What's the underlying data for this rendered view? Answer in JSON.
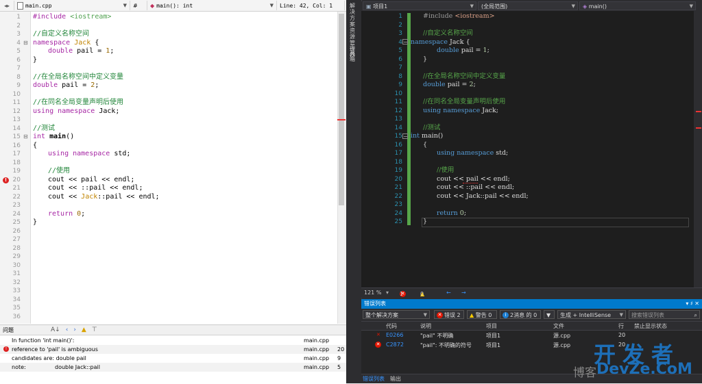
{
  "left_editor": {
    "file_tab": "main.cpp",
    "symbol_hash": "#",
    "function_sig": "main(): int",
    "position": "Line: 42, Col: 1",
    "line_numbers": [
      "1",
      "2",
      "3",
      "4",
      "5",
      "6",
      "7",
      "8",
      "9",
      "10",
      "11",
      "12",
      "13",
      "14",
      "15",
      "16",
      "17",
      "18",
      "19",
      "20",
      "21",
      "22",
      "23",
      "24",
      "25",
      "26",
      "27",
      "28",
      "29",
      "30",
      "31",
      "32",
      "33",
      "34",
      "35",
      "36"
    ],
    "code": {
      "l1_kw": "#include",
      "l1_inc": " <iostream>",
      "l3": "//自定义名称空间",
      "l4_kw": "namespace",
      "l4_name": " Jack",
      "l4_rest": " {",
      "l5_ty": "double",
      "l5_rest": " pail = ",
      "l5_num": "1",
      "l5_end": ";",
      "l6": "}",
      "l8": "//在全局名称空间中定义变量",
      "l9_ty": "double",
      "l9_rest": " pail = ",
      "l9_num": "2",
      "l9_end": ";",
      "l11": "//在同名全局变量声明后使用",
      "l12_kw": "using namespace",
      "l12_rest": " Jack;",
      "l14": "//测试",
      "l15_ty": "int",
      "l15_fn": " main",
      "l15_rest": "()",
      "l16": "{",
      "l17_kw": "using namespace",
      "l17_rest": " std;",
      "l19": "//使用",
      "l20": "cout << pail << endl;",
      "l21": "cout << ::pail << endl;",
      "l22_a": "cout << ",
      "l22_ns": "Jack",
      "l22_b": "::pail << endl;",
      "l24_kw": "return",
      "l24_num": " 0",
      "l24_end": ";",
      "l25": "}"
    }
  },
  "problems": {
    "title": "问题",
    "rows": [
      {
        "msg": "In function 'int main()':",
        "file": "main.cpp",
        "line": ""
      },
      {
        "msg": "reference to 'pail' is ambiguous",
        "file": "main.cpp",
        "line": "20"
      },
      {
        "msg": "candidates are: double pail",
        "file": "main.cpp",
        "line": "9"
      },
      {
        "msg": "note:",
        "msg2": "double Jack::pail",
        "file": "main.cpp",
        "line": "5"
      }
    ]
  },
  "vs": {
    "side_tabs": [
      "解决方案资源管理器",
      "工具箱"
    ],
    "nav_project": "项目1",
    "nav_scope": "(全局范围)",
    "nav_func": "main()",
    "line_numbers": [
      "1",
      "2",
      "3",
      "4",
      "5",
      "6",
      "7",
      "8",
      "9",
      "10",
      "11",
      "12",
      "13",
      "14",
      "15",
      "16",
      "17",
      "18",
      "19",
      "20",
      "21",
      "22",
      "23",
      "24",
      "25"
    ],
    "code": {
      "l1_pre": "#include",
      "l1_inc": " <iostream>",
      "l3": "//自定义名称空间",
      "l4_kw": "namespace",
      "l4_rest": " Jack {",
      "l5_kw": "double",
      "l5_rest": " pail = ",
      "l5_num": "1",
      "l5_end": ";",
      "l6": "}",
      "l8": "//在全局名称空间中定义变量",
      "l9_kw": "double",
      "l9_rest": " pail = ",
      "l9_num": "2",
      "l9_end": ";",
      "l11": "//在同名全局变量声明后使用",
      "l12_kw": "using namespace",
      "l12_rest": " Jack;",
      "l14": "//测试",
      "l15_kw": "int",
      "l15_rest": " main()",
      "l16": "{",
      "l17_kw": "using namespace",
      "l17_rest": " std;",
      "l19": "//使用",
      "l20": "cout << pail << endl;",
      "l21": "cout << ::pail << endl;",
      "l22": "cout << Jack::pail << endl;",
      "l24_kw": "return",
      "l24_rest": " ",
      "l24_num": "0",
      "l24_end": ";",
      "l25": "}"
    },
    "status": {
      "zoom": "121 %",
      "errors": "1",
      "warnings": "0",
      "nav_back": "←",
      "nav_fwd": "→"
    }
  },
  "error_list": {
    "title": "错误列表",
    "controls": "▾ ♯ ✕",
    "scope": "整个解决方案",
    "errors_label": "错误 2",
    "warnings_label": "警告 0",
    "messages_label": "2消息 的 0",
    "build_filter": "生成 + IntelliSense",
    "search_placeholder": "搜索错误列表",
    "columns": {
      "code": "代码",
      "desc": "说明",
      "project": "项目",
      "file": "文件",
      "line": "行",
      "suppress": "禁止显示状态"
    },
    "rows": [
      {
        "code": "E0266",
        "desc": "\"pail\" 不明确",
        "project": "项目1",
        "file": "源.cpp",
        "line": "20"
      },
      {
        "code": "C2872",
        "desc": "\"pail\": 不明确的符号",
        "project": "项目1",
        "file": "源.cpp",
        "line": "20"
      }
    ],
    "tabs": [
      "错误列表",
      "输出"
    ]
  },
  "watermark": {
    "big": "开发者",
    "small": "DevZe.CoM",
    "prefix": "博客"
  }
}
